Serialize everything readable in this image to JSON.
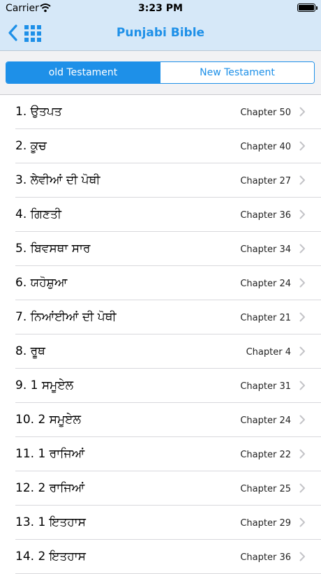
{
  "status": {
    "carrier": "Carrier",
    "time": "3:23 PM"
  },
  "nav": {
    "title": "Punjabi Bible"
  },
  "segments": {
    "old": "old Testament",
    "new": "New Testament"
  },
  "books": [
    {
      "name": "1. ਉਤਪਤ",
      "chapter": "Chapter 50"
    },
    {
      "name": "2. ਕੂਚ",
      "chapter": "Chapter 40"
    },
    {
      "name": "3. ਲੇਵੀਆਂ ਦੀ ਪੋਥੀ",
      "chapter": "Chapter 27"
    },
    {
      "name": "4. ਗਿਣਤੀ",
      "chapter": "Chapter 36"
    },
    {
      "name": "5. ਬਿਵਸਥਾ ਸਾਰ",
      "chapter": "Chapter 34"
    },
    {
      "name": "6. ਯਹੋਸ਼ੁਆ",
      "chapter": "Chapter 24"
    },
    {
      "name": "7. ਨਿਆਂਈਆਂ ਦੀ ਪੋਥੀ",
      "chapter": "Chapter 21"
    },
    {
      "name": "8. ਰੂਥ",
      "chapter": "Chapter 4"
    },
    {
      "name": "9. 1 ਸਮੂਏਲ",
      "chapter": "Chapter 31"
    },
    {
      "name": "10. 2 ਸਮੂਏਲ",
      "chapter": "Chapter 24"
    },
    {
      "name": "11. 1 ਰਾਜਿਆਂ",
      "chapter": "Chapter 22"
    },
    {
      "name": "12. 2 ਰਾਜਿਆਂ",
      "chapter": "Chapter 25"
    },
    {
      "name": "13. 1 ਇਤਹਾਸ",
      "chapter": "Chapter 29"
    },
    {
      "name": "14. 2 ਇਤਹਾਸ",
      "chapter": "Chapter 36"
    }
  ],
  "colors": {
    "accent": "#1e90e8",
    "bar": "#d6e8f8"
  }
}
